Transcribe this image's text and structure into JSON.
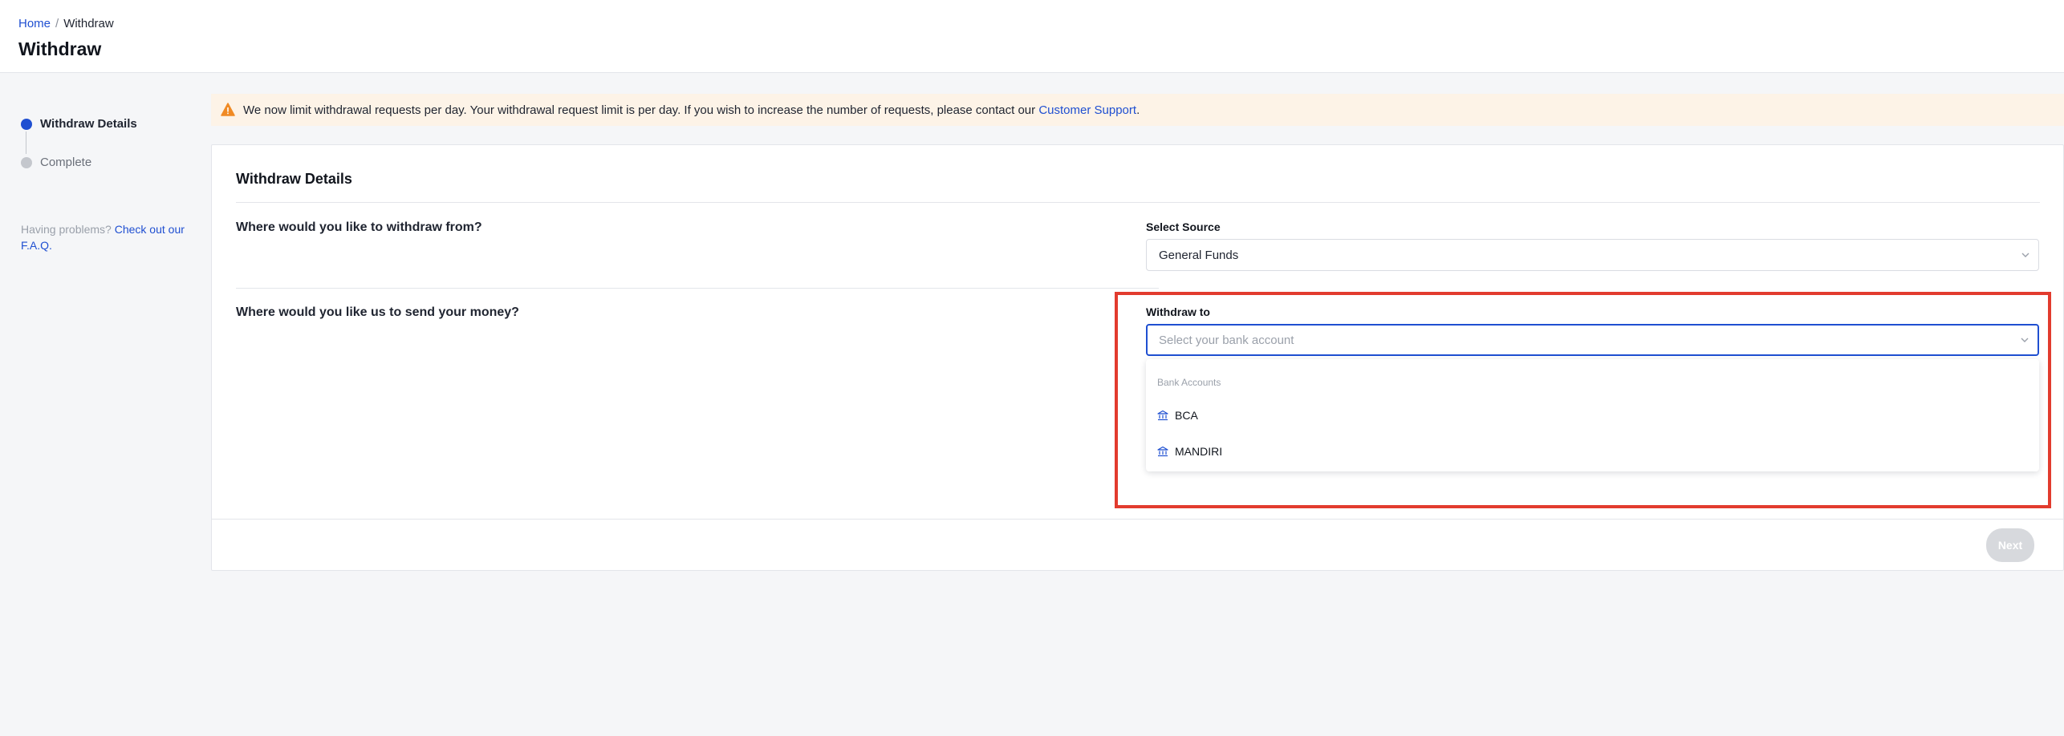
{
  "breadcrumb": {
    "home": "Home",
    "separator": "/",
    "current": "Withdraw"
  },
  "page_title": "Withdraw",
  "stepper": {
    "steps": [
      {
        "label": "Withdraw Details",
        "state": "active"
      },
      {
        "label": "Complete",
        "state": "inactive"
      }
    ]
  },
  "help": {
    "text": "Having problems?",
    "link": "Check out our F.A.Q."
  },
  "banner": {
    "icon": "warning-icon",
    "text": "We now limit withdrawal requests per day. Your withdrawal request limit is per day. If you wish to increase the number of requests, please contact our",
    "link": "Customer Support",
    "trail": "."
  },
  "card": {
    "title": "Withdraw Details",
    "source_question": "Where would you like to withdraw from?",
    "source_label": "Select Source",
    "source_value": "General Funds",
    "dest_question": "Where would you like us to send your money?",
    "dest_label": "Withdraw to",
    "dest_placeholder": "Select your bank account"
  },
  "dropdown": {
    "group_label": "Bank Accounts",
    "items": [
      {
        "label": "BCA",
        "icon": "bank-icon"
      },
      {
        "label": "MANDIRI",
        "icon": "bank-icon"
      }
    ]
  },
  "footer": {
    "next_label": "Next"
  },
  "colors": {
    "accent": "#1f4fd1",
    "highlight": "#e23b2e",
    "banner_bg": "#fdf3e7",
    "warning": "#f08a24"
  }
}
